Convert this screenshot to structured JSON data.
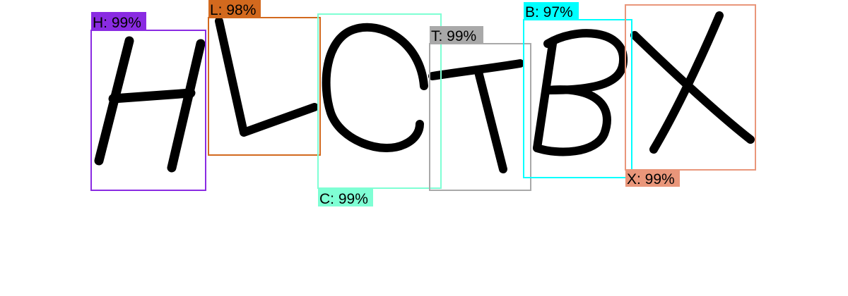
{
  "detections": [
    {
      "letter": "H",
      "confidence": "99%",
      "label": "H: 99%",
      "color": "#8a2be2"
    },
    {
      "letter": "L",
      "confidence": "98%",
      "label": "L: 98%",
      "color": "#d2691e"
    },
    {
      "letter": "C",
      "confidence": "99%",
      "label": "C: 99%",
      "color": "#7fffd4"
    },
    {
      "letter": "T",
      "confidence": "99%",
      "label": "T: 99%",
      "color": "#a9a9a9"
    },
    {
      "letter": "B",
      "confidence": "97%",
      "label": "B: 97%",
      "color": "#00ffff"
    },
    {
      "letter": "X",
      "confidence": "99%",
      "label": "X: 99%",
      "color": "#e9967a"
    }
  ]
}
